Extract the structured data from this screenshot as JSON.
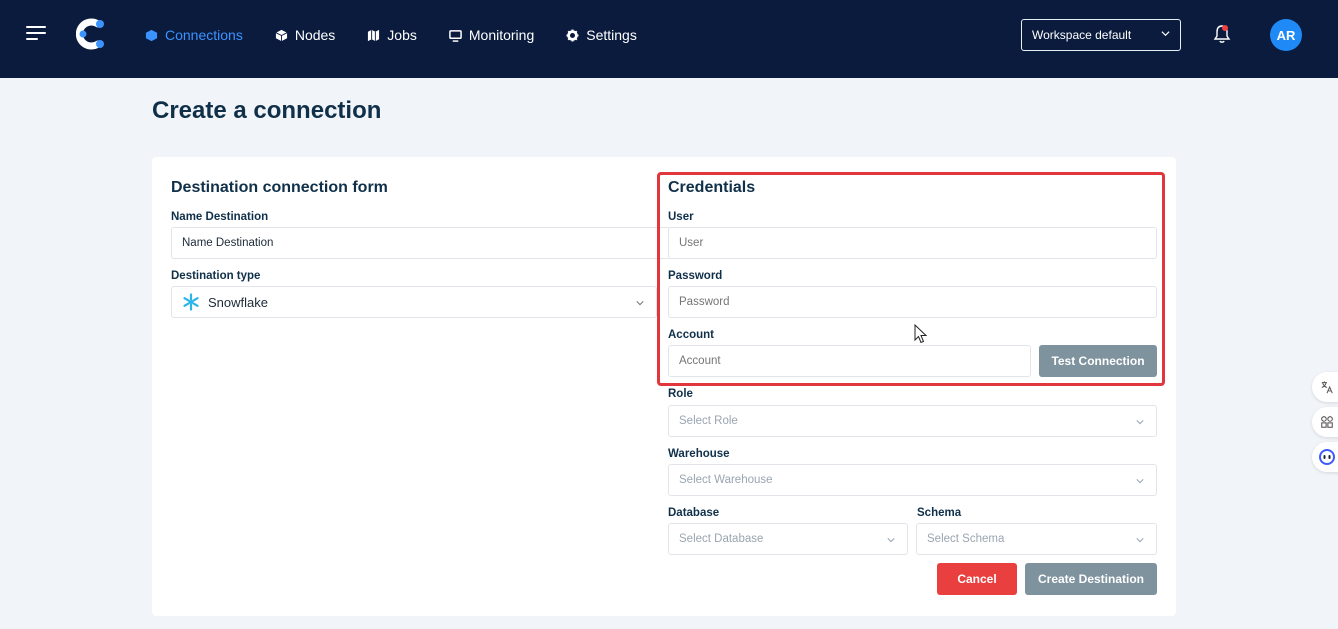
{
  "header": {
    "nav": [
      {
        "label": "Connections",
        "icon": "cube-icon",
        "active": true
      },
      {
        "label": "Nodes",
        "icon": "box-icon",
        "active": false
      },
      {
        "label": "Jobs",
        "icon": "map-icon",
        "active": false
      },
      {
        "label": "Monitoring",
        "icon": "monitor-icon",
        "active": false
      },
      {
        "label": "Settings",
        "icon": "gear-icon",
        "active": false
      }
    ],
    "workspace": "Workspace default",
    "avatar_initials": "AR"
  },
  "page": {
    "title": "Create a connection"
  },
  "destination_form": {
    "title": "Destination connection form",
    "name_label": "Name Destination",
    "name_value": "Name Destination",
    "type_label": "Destination type",
    "type_value": "Snowflake"
  },
  "credentials": {
    "title": "Credentials",
    "user_label": "User",
    "user_placeholder": "User",
    "password_label": "Password",
    "password_placeholder": "Password",
    "account_label": "Account",
    "account_placeholder": "Account",
    "test_button": "Test Connection",
    "role_label": "Role",
    "role_placeholder": "Select Role",
    "warehouse_label": "Warehouse",
    "warehouse_placeholder": "Select Warehouse",
    "database_label": "Database",
    "database_placeholder": "Select Database",
    "schema_label": "Schema",
    "schema_placeholder": "Select Schema"
  },
  "actions": {
    "cancel": "Cancel",
    "create": "Create Destination"
  },
  "colors": {
    "header_bg": "#0a1b3d",
    "accent": "#3b93ff",
    "danger": "#e9403f",
    "disabled_button": "#7f939f"
  }
}
